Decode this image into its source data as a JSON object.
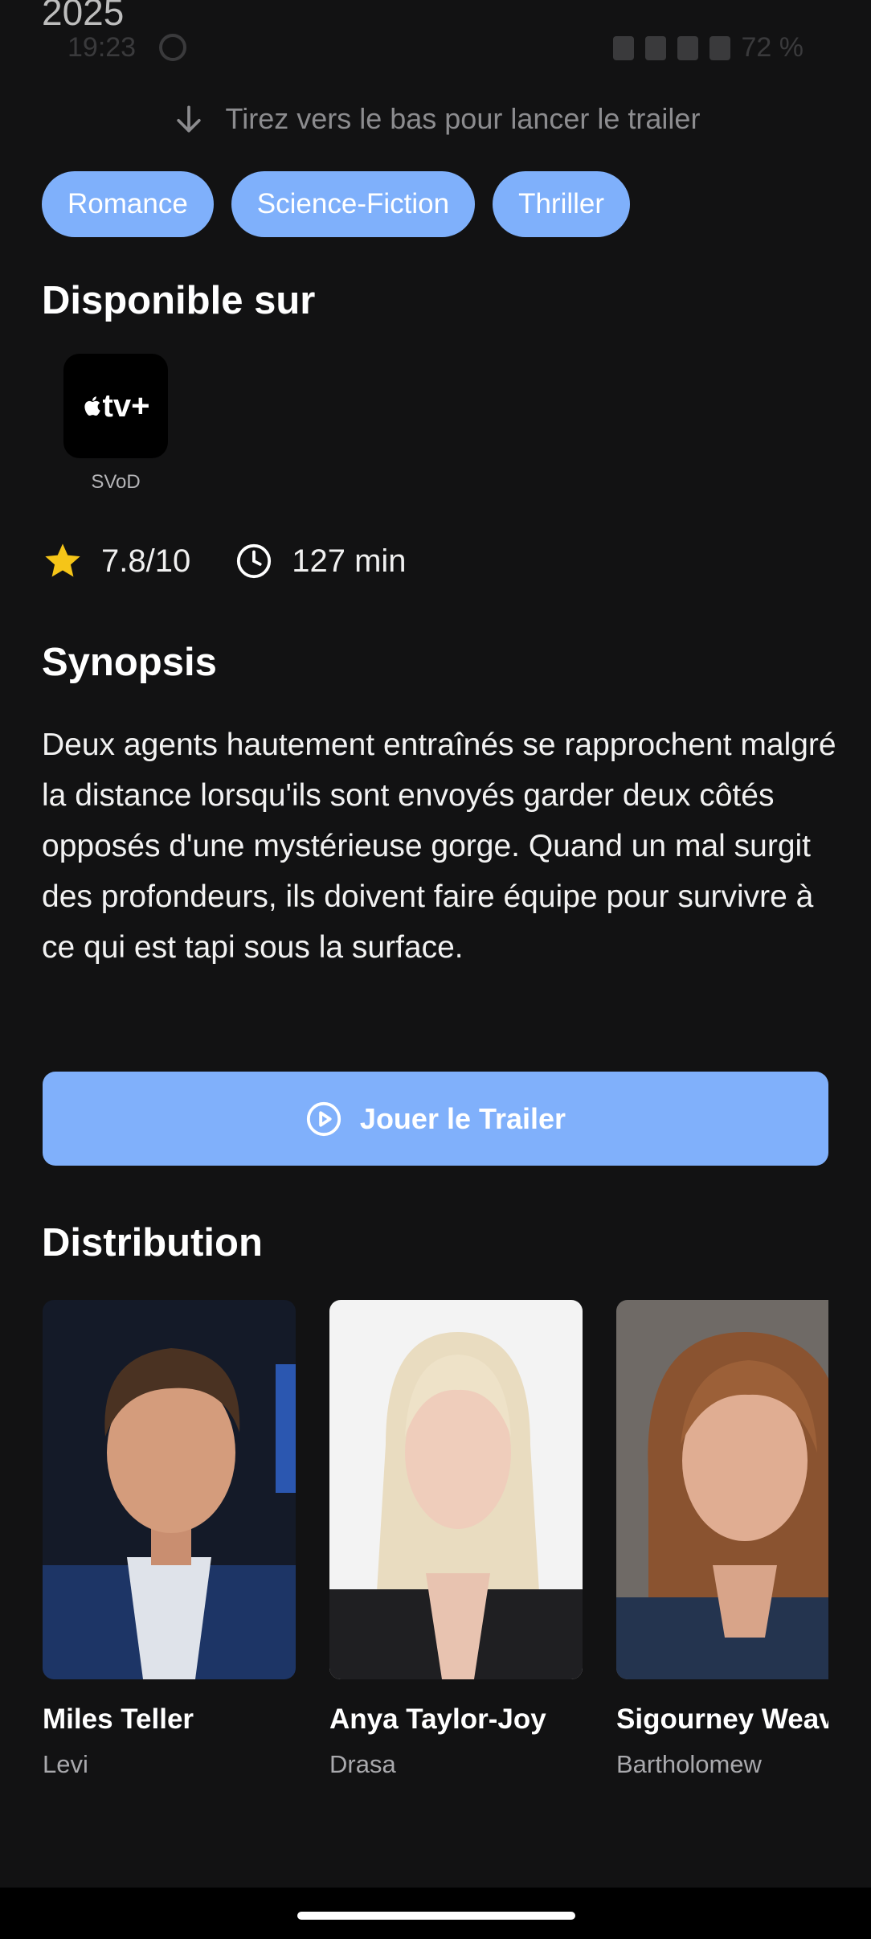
{
  "header": {
    "year": "2025"
  },
  "status_bar": {
    "time": "19:23",
    "battery": "72 %"
  },
  "pull_hint": {
    "text": "Tirez vers le bas pour lancer le trailer",
    "icon": "arrow-down-icon"
  },
  "genres": [
    "Romance",
    "Science-Fiction",
    "Thriller"
  ],
  "availability": {
    "title": "Disponible sur",
    "providers": [
      {
        "logo_text": "tv+",
        "type": "SVoD"
      }
    ]
  },
  "meta": {
    "rating": "7.8/10",
    "runtime": "127 min"
  },
  "synopsis": {
    "title": "Synopsis",
    "text": "Deux agents hautement entraînés se rapprochent malgré la distance lorsqu'ils sont envoyés garder deux côtés opposés d'une mystérieuse gorge. Quand un mal surgit des profondeurs, ils doivent faire équipe pour survivre à ce qui est tapi sous la surface."
  },
  "trailer_button": {
    "label": "Jouer le Trailer"
  },
  "cast": {
    "title": "Distribution",
    "members": [
      {
        "name": "Miles Teller",
        "role": "Levi"
      },
      {
        "name": "Anya Taylor-Joy",
        "role": "Drasa"
      },
      {
        "name": "Sigourney Weaver",
        "role": "Bartholomew"
      }
    ]
  },
  "colors": {
    "accent": "#7fb0fb",
    "background": "#121213",
    "star": "#f5c518"
  }
}
